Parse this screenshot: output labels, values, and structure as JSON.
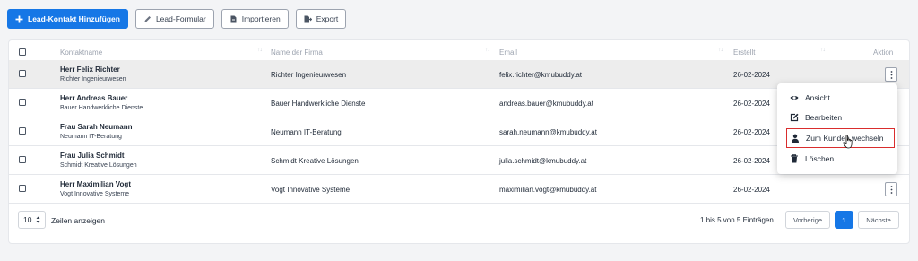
{
  "toolbar": {
    "add_label": "Lead-Kontakt Hinzufügen",
    "form_label": "Lead-Formular",
    "import_label": "Importieren",
    "export_label": "Export"
  },
  "table": {
    "headers": {
      "contact": "Kontaktname",
      "company": "Name der Firma",
      "email": "Email",
      "created": "Erstellt",
      "action": "Aktion"
    },
    "rows": [
      {
        "name": "Herr Felix Richter",
        "sub": "Richter Ingenieurwesen",
        "company": "Richter Ingenieurwesen",
        "email": "felix.richter@kmubuddy.at",
        "created": "26-02-2024"
      },
      {
        "name": "Herr Andreas Bauer",
        "sub": "Bauer Handwerkliche Dienste",
        "company": "Bauer Handwerkliche Dienste",
        "email": "andreas.bauer@kmubuddy.at",
        "created": "26-02-2024"
      },
      {
        "name": "Frau Sarah Neumann",
        "sub": "Neumann IT-Beratung",
        "company": "Neumann IT-Beratung",
        "email": "sarah.neumann@kmubuddy.at",
        "created": "26-02-2024"
      },
      {
        "name": "Frau Julia Schmidt",
        "sub": "Schmidt Kreative Lösungen",
        "company": "Schmidt Kreative Lösungen",
        "email": "julia.schmidt@kmubuddy.at",
        "created": "26-02-2024"
      },
      {
        "name": "Herr Maximilian Vogt",
        "sub": "Vogt Innovative Systeme",
        "company": "Vogt Innovative Systeme",
        "email": "maximilian.vogt@kmubuddy.at",
        "created": "26-02-2024"
      }
    ]
  },
  "menu": {
    "view": "Ansicht",
    "edit": "Bearbeiten",
    "switch": "Zum Kunden wechseln",
    "delete": "Löschen"
  },
  "footer": {
    "page_size": "10",
    "page_size_label": "Zeilen anzeigen",
    "info": "1 bis 5 von 5 Einträgen",
    "prev": "Vorherige",
    "current": "1",
    "next": "Nächste"
  },
  "colors": {
    "accent": "#1677e6",
    "highlight_border": "#d92d2d",
    "row_highlight": "#ededed"
  }
}
